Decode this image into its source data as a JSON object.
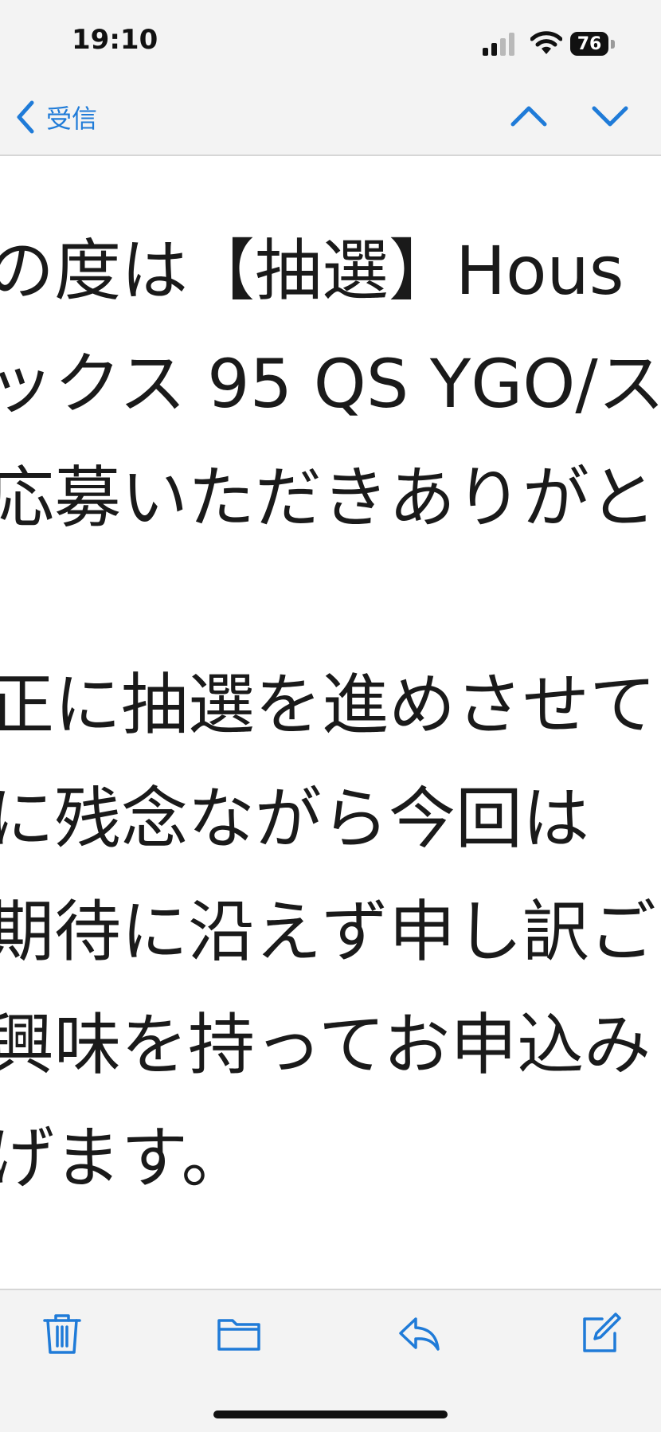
{
  "status_bar": {
    "time": "19:10",
    "battery": "76",
    "icons": [
      "signal-icon",
      "wifi-icon",
      "battery-icon"
    ]
  },
  "nav": {
    "back_label": "受信",
    "icons": [
      "chevron-left-icon",
      "chevron-up-icon",
      "chevron-down-icon"
    ]
  },
  "email_body": {
    "lines": [
      "の度は【抽選】Hous",
      "ックス 95 QS YGO/ス",
      "応募いただきありがと",
      "",
      "正に抽選を進めさせて",
      "に残念ながら今回は",
      "期待に沿えず申し訳ご",
      "興味を持ってお申込み",
      "げます。"
    ]
  },
  "toolbar": {
    "icons": [
      "trash-icon",
      "folder-icon",
      "reply-icon",
      "compose-icon"
    ]
  },
  "colors": {
    "accent": "#1f7bd8",
    "bar_background": "#f3f3f3",
    "text": "#1a1a1a"
  }
}
